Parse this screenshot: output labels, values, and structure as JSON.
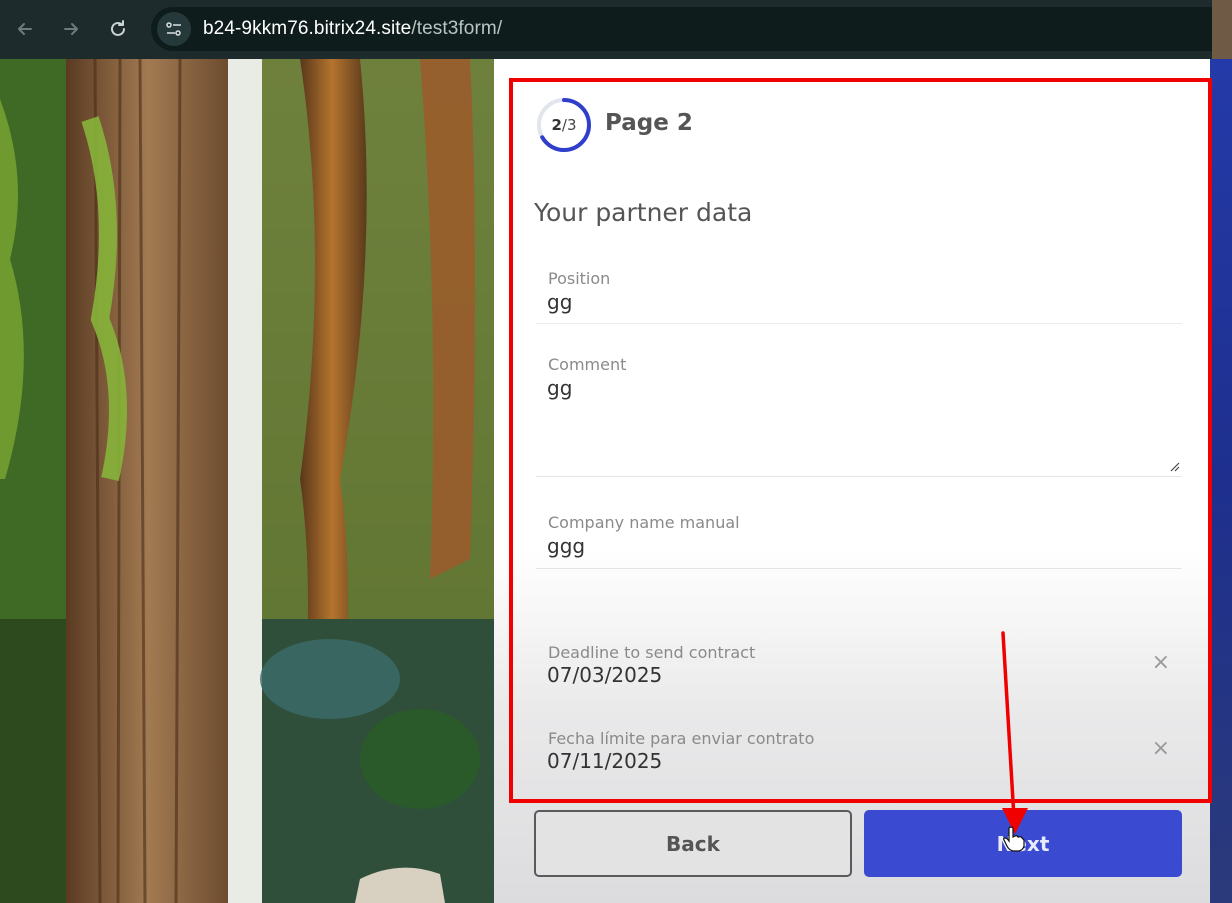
{
  "browser": {
    "url_host": "b24-9kkm76.bitrix24.site",
    "url_path": "/test3form/",
    "back_icon": "arrow-left-icon",
    "forward_icon": "arrow-right-icon",
    "reload_icon": "reload-icon",
    "site_info_icon": "tune-icon"
  },
  "form": {
    "progress": {
      "current": "2",
      "separator": "/",
      "total": "3",
      "fraction": 0.667
    },
    "page_title": "Page 2",
    "section_title": "Your partner data",
    "fields": {
      "position": {
        "label": "Position",
        "value": "gg"
      },
      "comment": {
        "label": "Comment",
        "value": "gg"
      },
      "company": {
        "label": "Company name manual",
        "value": "ggg"
      },
      "deadline": {
        "label": "Deadline to send contract",
        "value": "07/03/2025"
      },
      "fecha": {
        "label": "Fecha límite para enviar contrato",
        "value": "07/11/2025"
      }
    },
    "clear_glyph": "×",
    "buttons": {
      "back": "Back",
      "next": "Next"
    }
  },
  "colors": {
    "accent": "#3b4bd1",
    "progress_ring": "#2f3fcb",
    "annotation": "#f10000"
  }
}
